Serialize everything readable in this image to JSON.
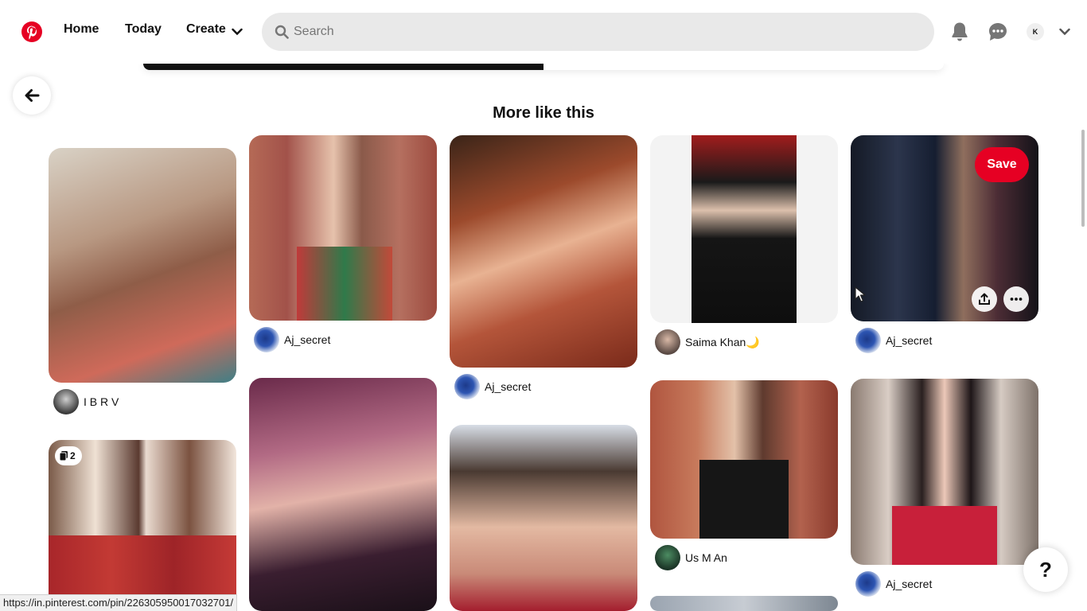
{
  "header": {
    "home_label": "Home",
    "today_label": "Today",
    "create_label": "Create",
    "search_placeholder": "Search",
    "avatar_initial": "K",
    "icons": [
      "pinterest-logo-icon",
      "chevron-down-icon",
      "search-icon",
      "bell-icon",
      "chat-icon",
      "chevron-down-icon"
    ]
  },
  "main": {
    "section_title": "More like this"
  },
  "pins": [
    {
      "owner": "I B R V"
    },
    {
      "owner": "Aj_secret"
    },
    {
      "owner": "Aj_secret"
    },
    {
      "owner": "Saima Khan🌙"
    },
    {
      "owner": "Aj_secret",
      "save_label": "Save",
      "hovered": true
    },
    {
      "owner": "",
      "badge_count": "2"
    },
    {
      "owner": ""
    },
    {
      "owner": ""
    },
    {
      "owner": "Us M An"
    },
    {
      "owner": "Aj_secret"
    },
    {
      "owner": ""
    }
  ],
  "help_label": "?",
  "status_url": "https://in.pinterest.com/pin/226305950017032701/",
  "colors": {
    "brand": "#e60023",
    "search_bg": "#e9e9e9",
    "text": "#111111"
  }
}
